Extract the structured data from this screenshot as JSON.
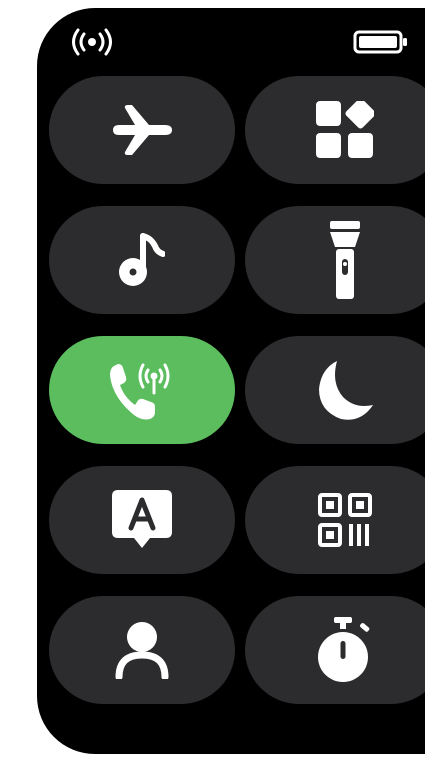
{
  "status_bar": {
    "signal_icon": "broadcast-signal-icon",
    "battery_icon": "battery-full-icon"
  },
  "colors": {
    "screen_background": "#000000",
    "tile_background": "#2c2c2e",
    "tile_active": "#5bbd5d",
    "icon": "#ffffff"
  },
  "tiles": [
    {
      "id": "airplane-mode",
      "icon": "airplane-icon",
      "active": false
    },
    {
      "id": "apps",
      "icon": "apps-grid-icon",
      "active": false
    },
    {
      "id": "music",
      "icon": "music-note-icon",
      "active": false
    },
    {
      "id": "flashlight",
      "icon": "flashlight-icon",
      "active": false
    },
    {
      "id": "phone-calling",
      "icon": "phone-broadcast-icon",
      "active": true
    },
    {
      "id": "do-not-disturb",
      "icon": "moon-icon",
      "active": false
    },
    {
      "id": "auto-language",
      "icon": "letter-a-bubble-icon",
      "active": false
    },
    {
      "id": "qr-code",
      "icon": "qr-code-icon",
      "active": false
    },
    {
      "id": "profile",
      "icon": "person-icon",
      "active": false
    },
    {
      "id": "stopwatch",
      "icon": "stopwatch-icon",
      "active": false
    }
  ]
}
